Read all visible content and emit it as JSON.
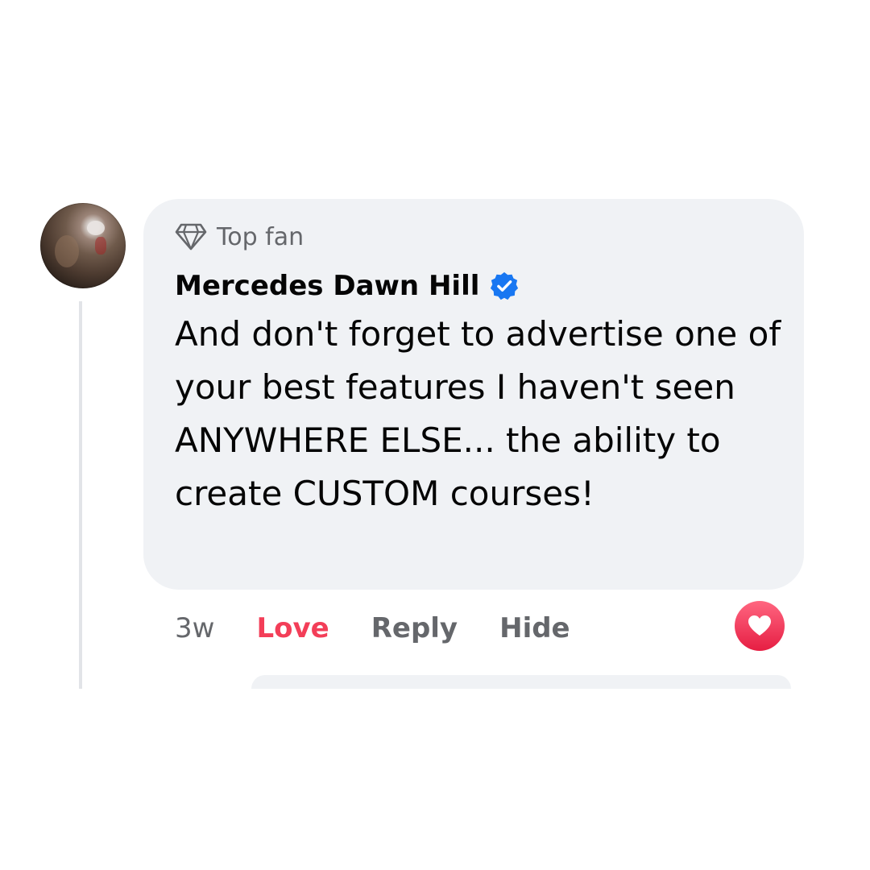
{
  "comment": {
    "badge": "Top fan",
    "author": "Mercedes Dawn Hill",
    "verified": true,
    "text": "And don't forget to advertise one of your best features I haven't seen ANYWHERE ELSE... the ability to create CUSTOM courses!",
    "actions": {
      "time": "3w",
      "love": "Love",
      "reply": "Reply",
      "hide": "Hide"
    },
    "reaction_icon": "heart-icon"
  },
  "colors": {
    "bubble": "#f0f2f5",
    "love": "#f33e58",
    "verified": "#1877f2",
    "secondary_text": "#65676b"
  }
}
